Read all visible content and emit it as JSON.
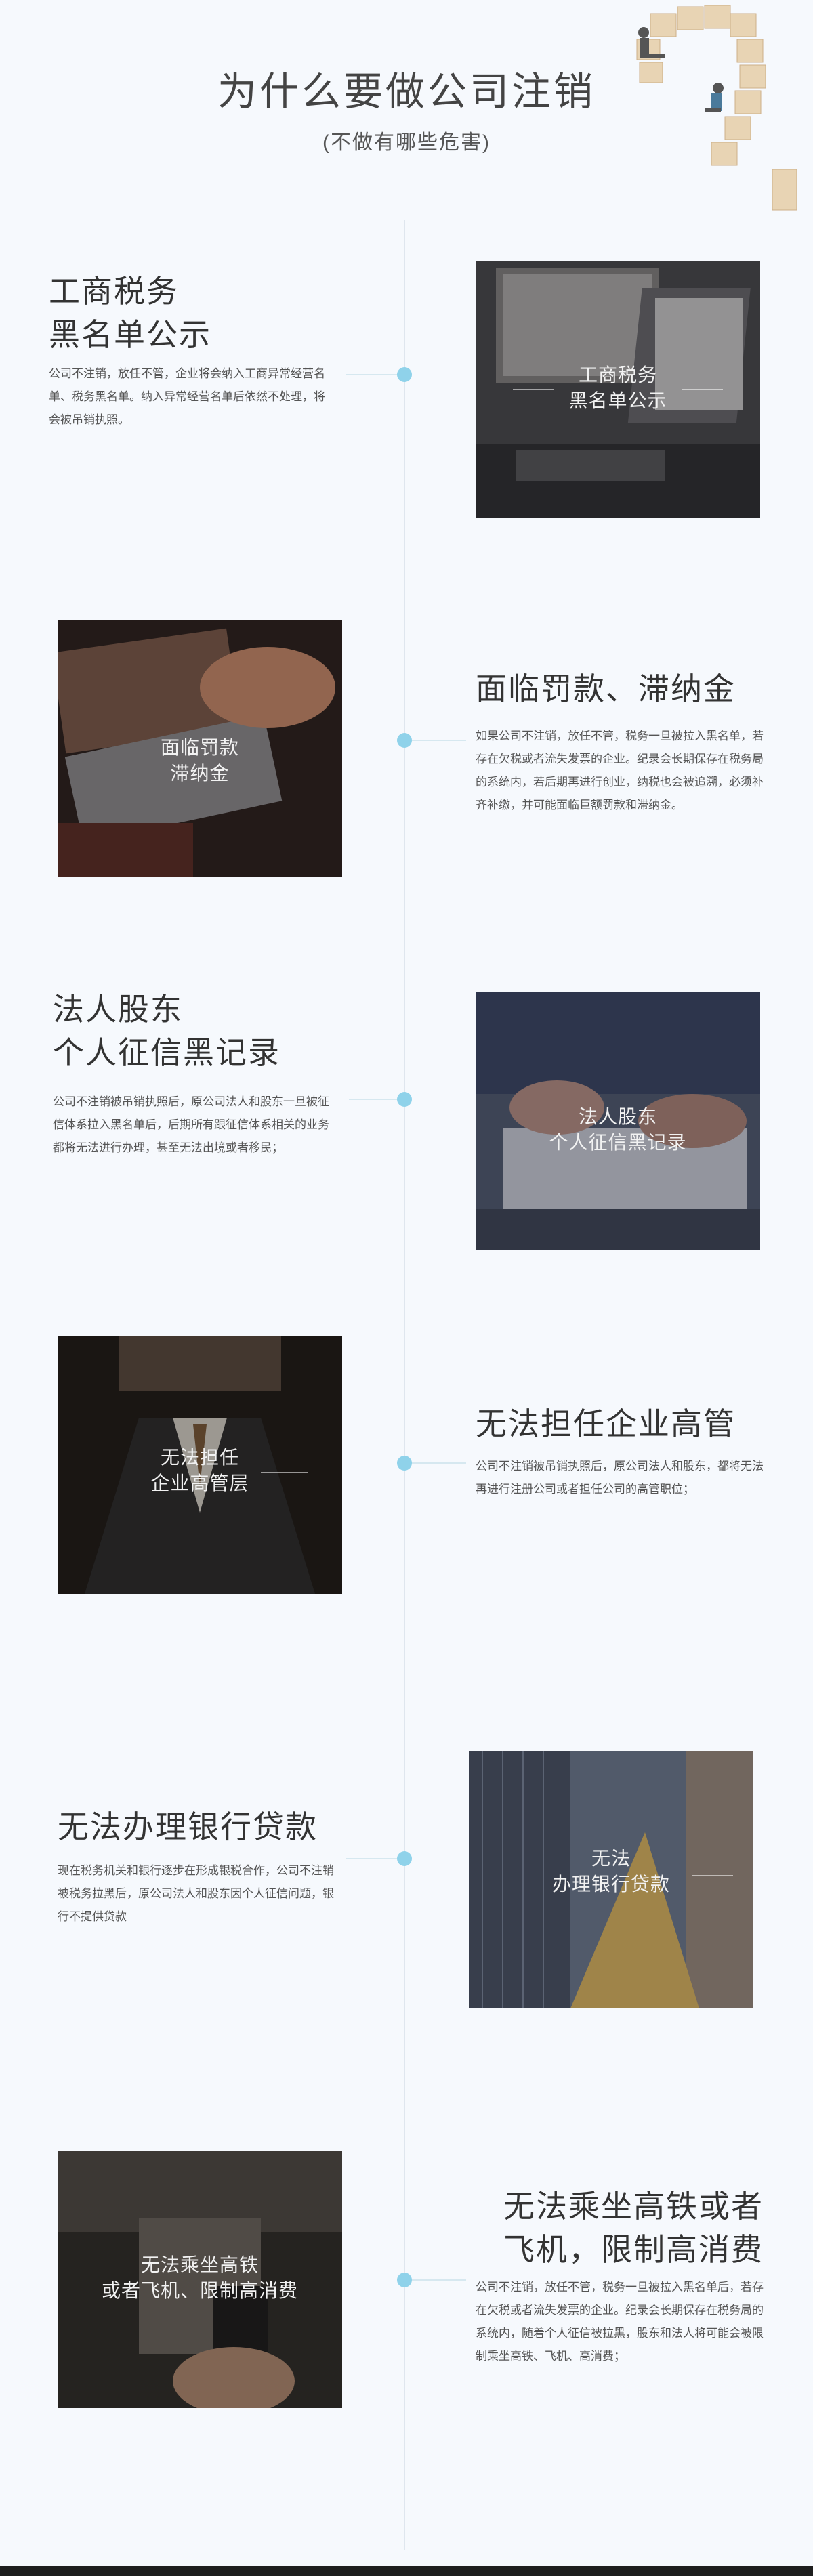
{
  "header": {
    "title": "为什么要做公司注销",
    "subtitle": "(不做有哪些危害)"
  },
  "sections": [
    {
      "heading": "工商税务\n黑名单公示",
      "body": "公司不注销，放任不管，企业将会纳入工商异常经营名单、税务黑名单。纳入异常经营名单后依然不处理，将会被吊销执照。",
      "image_label": "工商税务\n黑名单公示"
    },
    {
      "heading": "面临罚款、滞纳金",
      "body": "如果公司不注销，放任不管，税务一旦被拉入黑名单，若存在欠税或者流失发票的企业。纪录会长期保存在税务局的系统内，若后期再进行创业，纳税也会被追溯，必须补齐补缴，并可能面临巨额罚款和滞纳金。",
      "image_label": "面临罚款\n滞纳金"
    },
    {
      "heading": "法人股东\n个人征信黑记录",
      "body": "公司不注销被吊销执照后，原公司法人和股东一旦被征信体系拉入黑名单后，后期所有跟征信体系相关的业务都将无法进行办理，甚至无法出境或者移民；",
      "image_label": "法人股东\n个人征信黑记录"
    },
    {
      "heading": "无法担任企业高管",
      "body": "公司不注销被吊销执照后，原公司法人和股东，都将无法再进行注册公司或者担任公司的高管职位；",
      "image_label": "无法担任\n企业高管层"
    },
    {
      "heading": "无法办理银行贷款",
      "body": "现在税务机关和银行逐步在形成银税合作，公司不注销被税务拉黑后，原公司法人和股东因个人征信问题，银行不提供贷款",
      "image_label": "无法\n办理银行贷款"
    },
    {
      "heading": "无法乘坐高铁或者\n飞机，限制高消费",
      "body": "公司不注销，放任不管，税务一旦被拉入黑名单后，若存在欠税或者流失发票的企业。纪录会长期保存在税务局的系统内，随着个人征信被拉黑，股东和法人将可能会被限制乘坐高铁、飞机、高消费；",
      "image_label": "无法乘坐高铁\n或者飞机、限制高消费"
    }
  ],
  "colors": {
    "background": "#f6f9fd",
    "accent_dot": "#8fd2ea",
    "heading_text": "#333333"
  }
}
